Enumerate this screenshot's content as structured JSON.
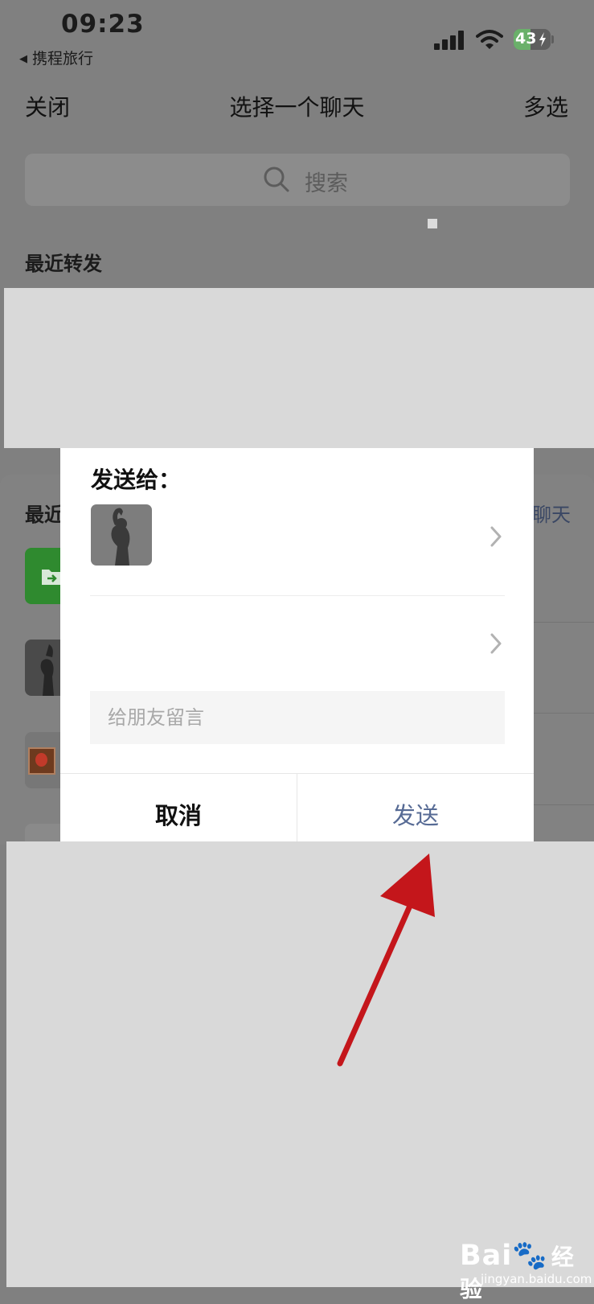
{
  "status_bar": {
    "time": "09:23",
    "back_app": "携程旅行",
    "battery": "43"
  },
  "header": {
    "close": "关闭",
    "title": "选择一个聊天",
    "multi_select": "多选"
  },
  "search": {
    "placeholder": "搜索"
  },
  "sections": {
    "recent_forward": "最近转发",
    "recent_chats": "最近",
    "more_chats_partial": "聊天"
  },
  "dialog": {
    "title": "发送给：",
    "message_placeholder": "给朋友留言",
    "cancel": "取消",
    "send": "发送"
  },
  "watermark": {
    "logo_text": "Bai",
    "logo_suffix": "经验",
    "url": "jingyan.baidu.com"
  },
  "colors": {
    "overlay": "#808080",
    "send_text": "#576b95",
    "arrow": "#c4161b",
    "file_icon_green": "#2f8a2f"
  }
}
